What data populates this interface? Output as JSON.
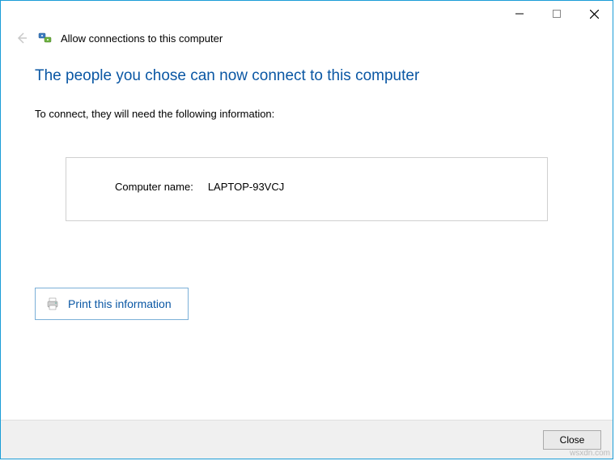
{
  "titlebar": {
    "minimize_icon": "minimize-icon",
    "maximize_icon": "maximize-icon",
    "close_icon": "close-icon"
  },
  "header": {
    "back_icon": "back-arrow-icon",
    "app_icon": "computer-network-icon",
    "title": "Allow connections to this computer"
  },
  "main": {
    "heading": "The people you chose can now connect to this computer",
    "subtext": "To connect, they will need the following information:",
    "info": {
      "computer_name_label": "Computer name:",
      "computer_name_value": "LAPTOP-93VCJ"
    },
    "print": {
      "icon": "printer-icon",
      "label": "Print this information"
    }
  },
  "footer": {
    "close_label": "Close"
  },
  "watermark": "wsxdn.com"
}
